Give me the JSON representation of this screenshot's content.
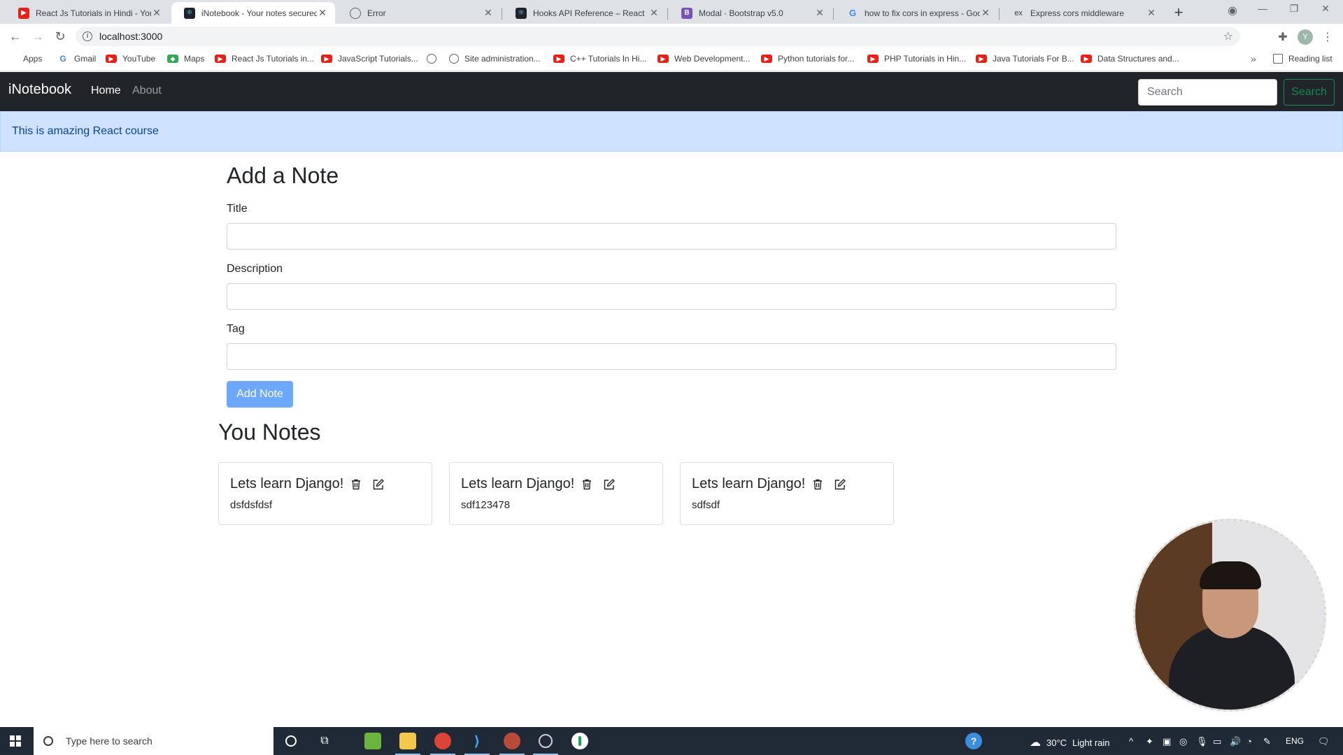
{
  "browser": {
    "tabs": [
      {
        "title": "React Js Tutorials in Hindi - YouTube",
        "favicon": "youtube-icon",
        "active": false
      },
      {
        "title": "iNotebook - Your notes secured",
        "favicon": "react-icon",
        "active": true
      },
      {
        "title": "Error",
        "favicon": "globe-icon",
        "active": false
      },
      {
        "title": "Hooks API Reference – React",
        "favicon": "react-icon",
        "active": false
      },
      {
        "title": "Modal · Bootstrap v5.0",
        "favicon": "bootstrap-icon",
        "active": false
      },
      {
        "title": "how to fix cors in express - Google",
        "favicon": "google-icon",
        "active": false
      },
      {
        "title": "Express cors middleware",
        "favicon": "express-icon",
        "active": false
      }
    ],
    "url": "localhost:3000",
    "bookmarks": [
      {
        "label": "Apps",
        "icon": "apps-grid-icon"
      },
      {
        "label": "Gmail",
        "icon": "google-icon"
      },
      {
        "label": "YouTube",
        "icon": "youtube-icon"
      },
      {
        "label": "Maps",
        "icon": "maps-icon"
      },
      {
        "label": "React Js Tutorials in...",
        "icon": "youtube-icon"
      },
      {
        "label": "JavaScript Tutorials...",
        "icon": "youtube-icon"
      },
      {
        "label": "",
        "icon": "globe-icon"
      },
      {
        "label": "Site administration...",
        "icon": "globe-icon"
      },
      {
        "label": "C++ Tutorials In Hi...",
        "icon": "youtube-icon"
      },
      {
        "label": "Web Development...",
        "icon": "youtube-icon"
      },
      {
        "label": "Python tutorials for...",
        "icon": "youtube-icon"
      },
      {
        "label": "PHP Tutorials in Hin...",
        "icon": "youtube-icon"
      },
      {
        "label": "Java Tutorials For B...",
        "icon": "youtube-icon"
      },
      {
        "label": "Data Structures and...",
        "icon": "youtube-icon"
      }
    ],
    "reading_list": "Reading list"
  },
  "app": {
    "brand": "iNotebook",
    "nav": {
      "home": "Home",
      "about": "About"
    },
    "search": {
      "placeholder": "Search",
      "button": "Search"
    },
    "alert": "This is amazing React course",
    "form": {
      "heading": "Add a Note",
      "title_label": "Title",
      "description_label": "Description",
      "tag_label": "Tag",
      "title_value": "",
      "description_value": "",
      "tag_value": "",
      "submit": "Add Note"
    },
    "notes_heading": "You Notes",
    "notes": [
      {
        "title": "Lets learn Django!",
        "description": "dsfdsfdsf"
      },
      {
        "title": "Lets learn Django!",
        "description": "sdf123478"
      },
      {
        "title": "Lets learn Django!",
        "description": "sdfsdf"
      }
    ]
  },
  "taskbar": {
    "search_placeholder": "Type here to search",
    "weather": {
      "temp": "30°C",
      "condition": "Light rain"
    },
    "language": "ENG"
  },
  "colors": {
    "navbar": "#212529",
    "alert_bg": "#cfe2ff",
    "primary_button": "#6ea8fe",
    "success_outline": "#198754"
  }
}
